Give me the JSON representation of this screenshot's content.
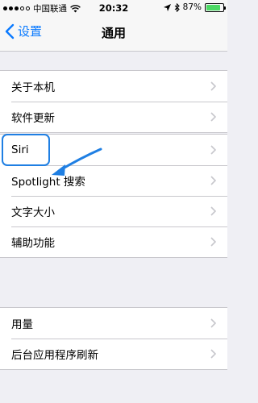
{
  "status_bar": {
    "carrier": "中国联通",
    "time": "20:32",
    "battery": "87%",
    "battery_level": 0.87,
    "icons": [
      "signal-dots-icon",
      "wifi-icon",
      "location-icon",
      "bluetooth-icon",
      "battery-icon"
    ]
  },
  "nav": {
    "back_label": "设置",
    "title": "通用"
  },
  "groups": [
    {
      "items": [
        {
          "label": "关于本机"
        },
        {
          "label": "软件更新"
        }
      ]
    },
    {
      "items": [
        {
          "label": "Siri"
        },
        {
          "label": "Spotlight 搜索"
        },
        {
          "label": "文字大小"
        },
        {
          "label": "辅助功能"
        }
      ]
    },
    {
      "items": [
        {
          "label": "用量"
        },
        {
          "label": "后台应用程序刷新"
        }
      ]
    }
  ],
  "annotation": {
    "highlight_color": "#1f7fe3",
    "target": "Siri"
  },
  "colors": {
    "accent": "#0a7aff",
    "background": "#efeff4",
    "battery": "#4cd964"
  }
}
